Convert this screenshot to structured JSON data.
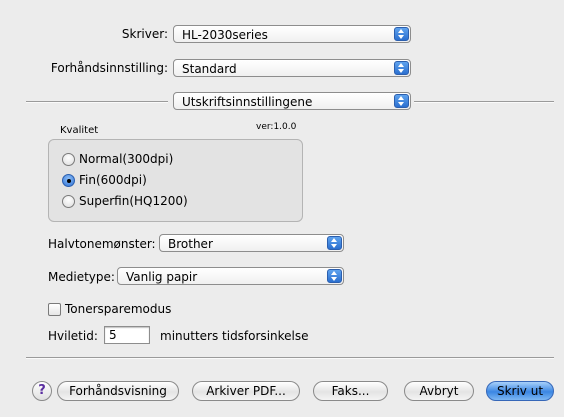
{
  "printer": {
    "label": "Skriver:",
    "value": "HL-2030series"
  },
  "preset": {
    "label": "Forhåndsinnstilling:",
    "value": "Standard"
  },
  "panel": {
    "value": "Utskriftsinnstillingene"
  },
  "quality": {
    "title": "Kvalitet",
    "version": "ver:1.0.0",
    "options": [
      "Normal(300dpi)",
      "Fin(600dpi)",
      "Superfin(HQ1200)"
    ],
    "selected": "Fin(600dpi)"
  },
  "halftone": {
    "label": "Halvtonemønster:",
    "value": "Brother"
  },
  "media": {
    "label": "Medietype:",
    "value": "Vanlig papir"
  },
  "toner": {
    "label": "Tonersparemodus",
    "checked": false
  },
  "sleep": {
    "label": "Hviletid:",
    "value": "5",
    "suffix": "minutters tidsforsinkelse"
  },
  "buttons": {
    "help": "?",
    "preview": "Forhåndsvisning",
    "pdf": "Arkiver PDF...",
    "fax": "Faks...",
    "cancel": "Avbryt",
    "print": "Skriv ut"
  }
}
